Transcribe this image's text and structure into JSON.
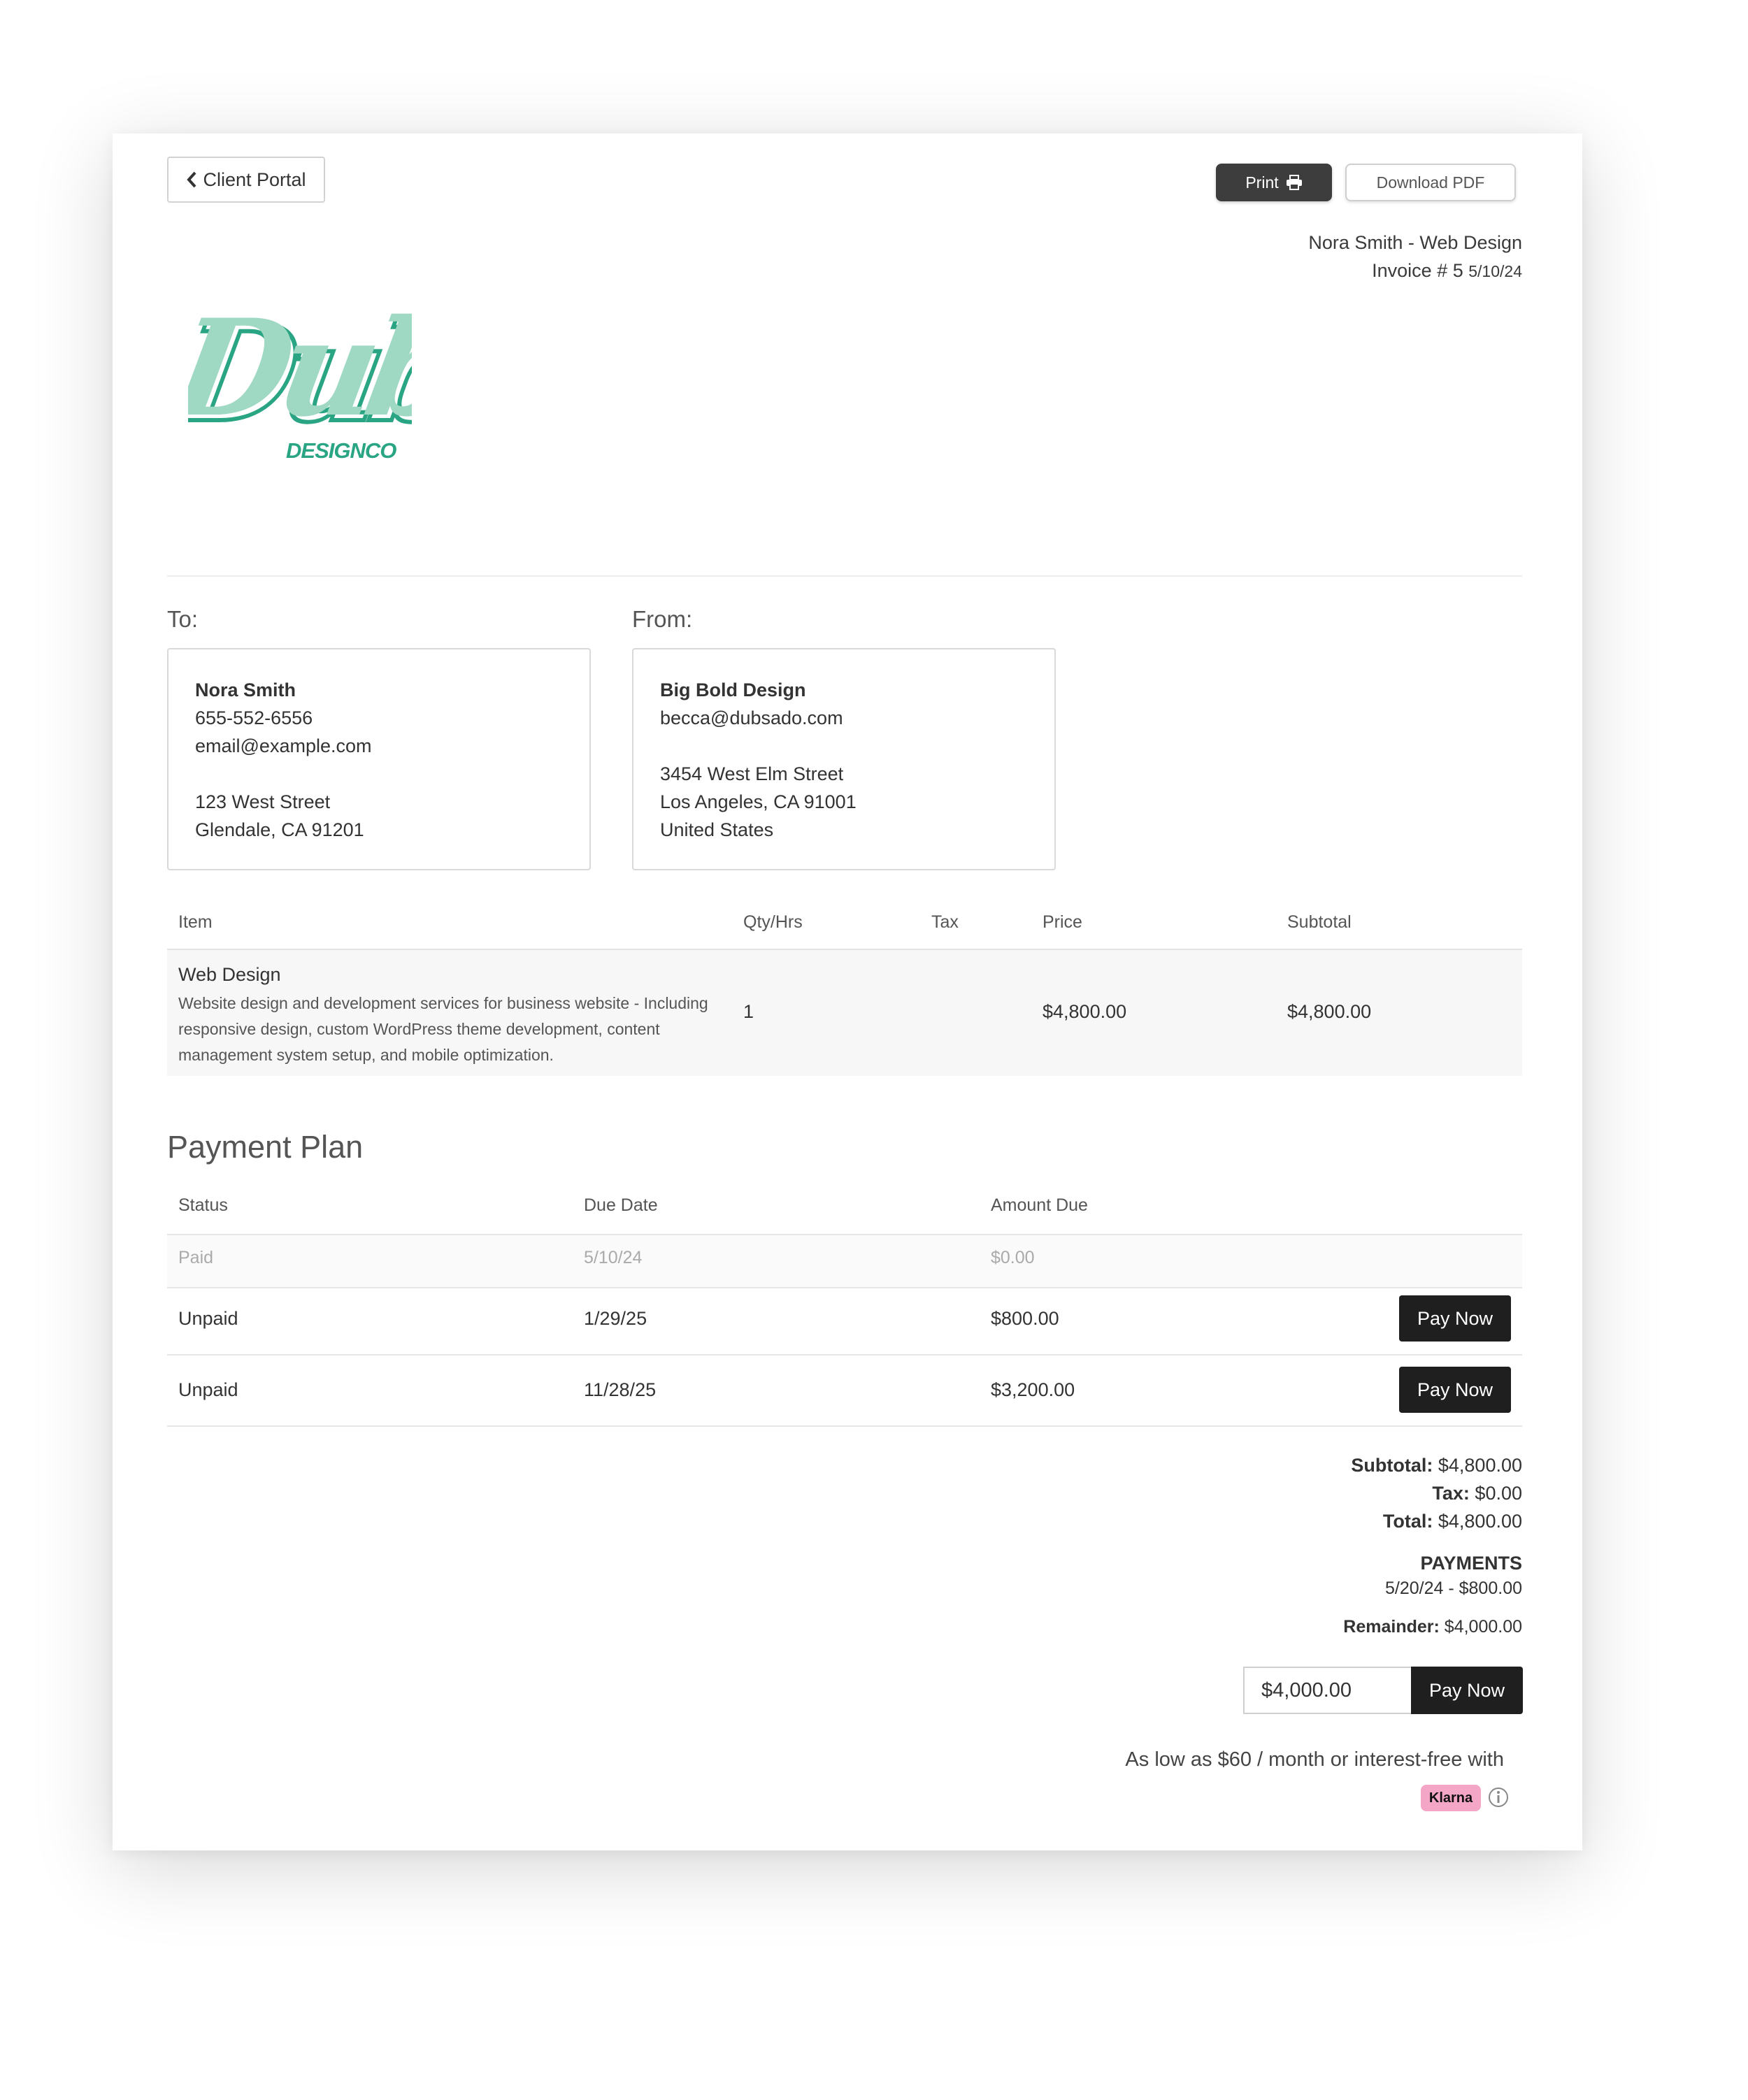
{
  "nav": {
    "back_label": "Client Portal",
    "print_label": "Print",
    "download_label": "Download PDF"
  },
  "header": {
    "project": "Nora Smith - Web Design",
    "invoice_label": "Invoice # 5",
    "invoice_date": "5/10/24"
  },
  "logo": {
    "script": "Dub",
    "subtitle": "DESIGNCO",
    "color": "#9fd9c3",
    "accent": "#2aa583"
  },
  "to": {
    "label": "To:",
    "name": "Nora Smith",
    "phone": "655-552-6556",
    "email": "email@example.com",
    "street": "123 West Street",
    "city": "Glendale, CA 91201"
  },
  "from": {
    "label": "From:",
    "name": "Big Bold Design",
    "email": "becca@dubsado.com",
    "street": "3454 West Elm Street",
    "city": "Los Angeles, CA 91001",
    "country": "United States"
  },
  "items_table": {
    "headers": [
      "Item",
      "Qty/Hrs",
      "Tax",
      "Price",
      "Subtotal"
    ],
    "rows": [
      {
        "title": "Web Design",
        "description": "Website design and development services for business website - Including responsive design, custom WordPress theme development, content management system setup, and mobile optimization.",
        "qty": "1",
        "tax": "",
        "price": "$4,800.00",
        "subtotal": "$4,800.00"
      }
    ]
  },
  "payment_plan": {
    "title": "Payment Plan",
    "headers": [
      "Status",
      "Due Date",
      "Amount Due"
    ],
    "rows": [
      {
        "status": "Paid",
        "due": "5/10/24",
        "amount": "$0.00"
      },
      {
        "status": "Unpaid",
        "due": "1/29/25",
        "amount": "$800.00",
        "action": "Pay Now"
      },
      {
        "status": "Unpaid",
        "due": "11/28/25",
        "amount": "$3,200.00",
        "action": "Pay Now"
      }
    ]
  },
  "totals": {
    "subtotal_label": "Subtotal:",
    "subtotal": "$4,800.00",
    "tax_label": "Tax:",
    "tax": "$0.00",
    "total_label": "Total:",
    "total": "$4,800.00",
    "payments_label": "PAYMENTS",
    "payment_entry": "5/20/24 - $800.00",
    "remainder_label": "Remainder:",
    "remainder": "$4,000.00"
  },
  "pay": {
    "amount_value": "$4,000.00",
    "button_label": "Pay Now"
  },
  "klarna": {
    "text": "As low as $60 / month or interest-free with",
    "badge": "Klarna"
  }
}
